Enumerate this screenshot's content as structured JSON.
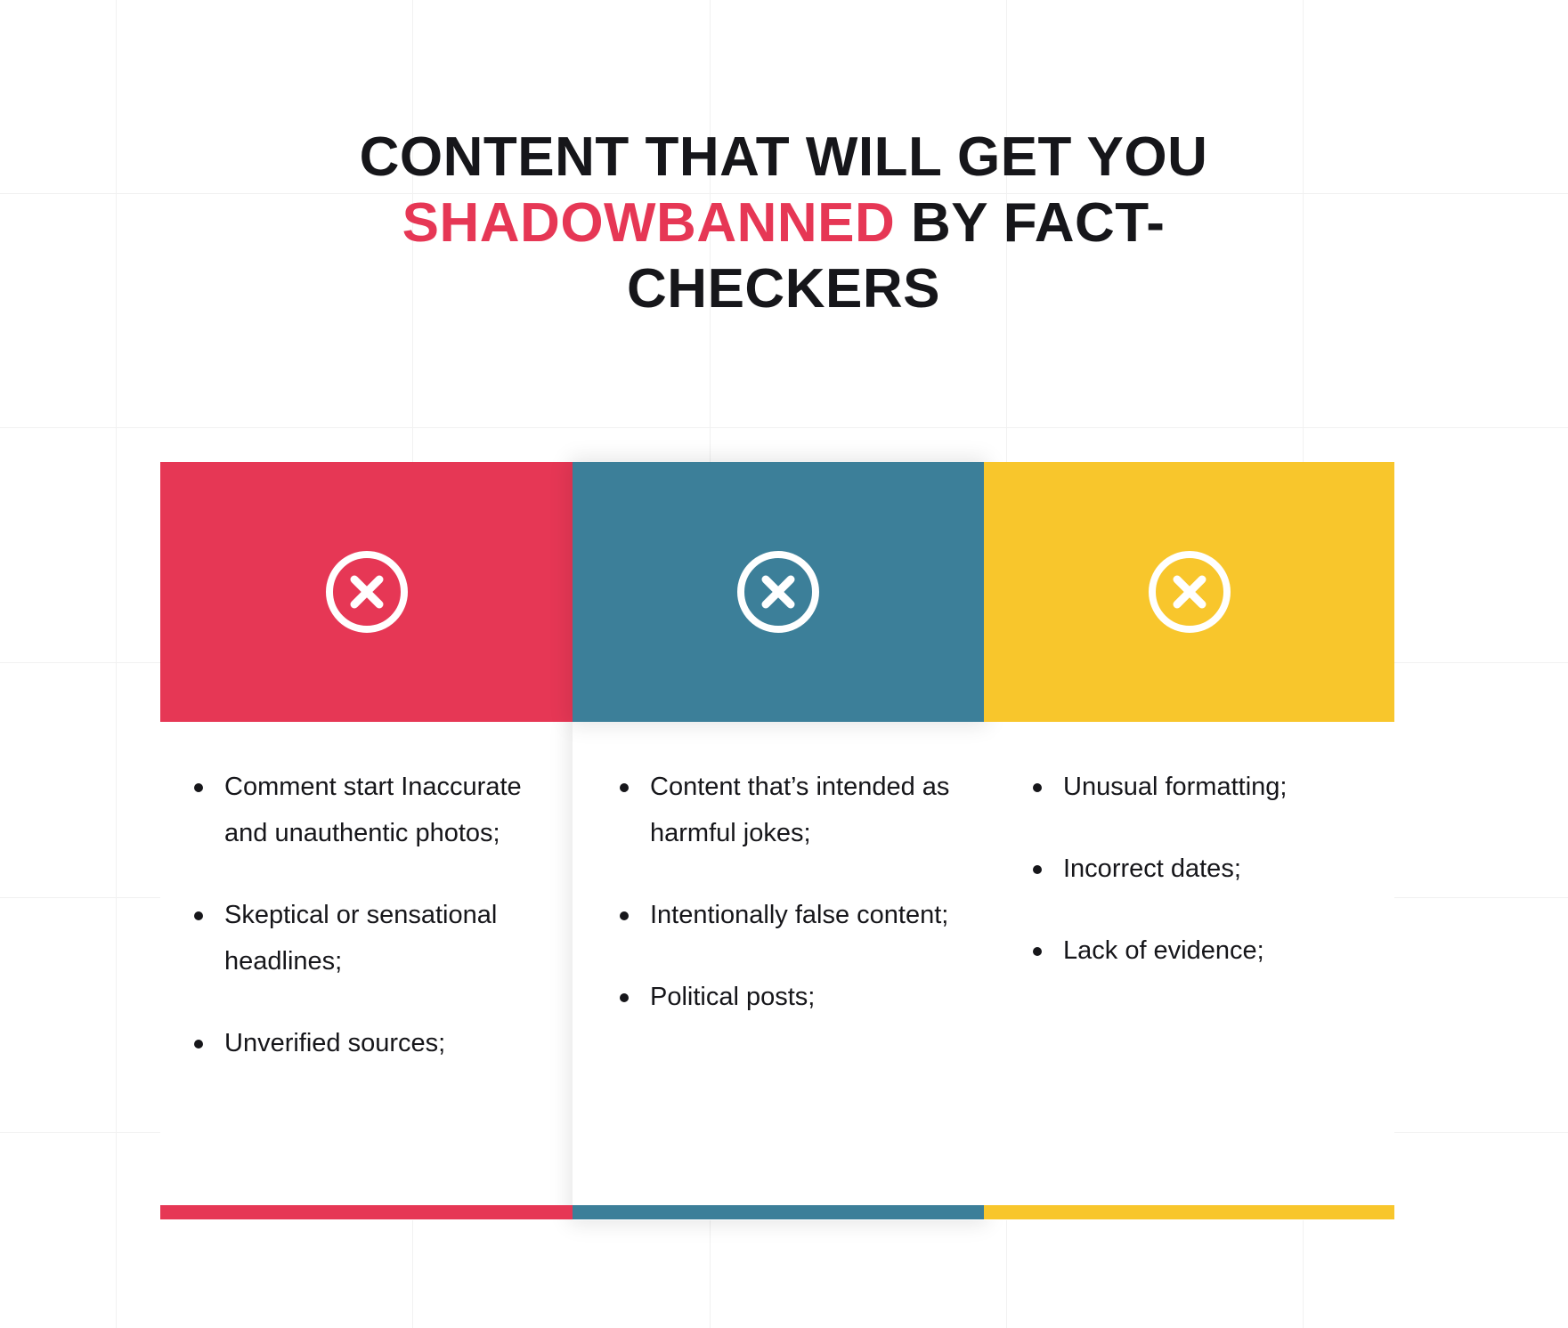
{
  "title": {
    "part1": "Content that will get you ",
    "highlight": "shadowbanned",
    "part2": " by fact-checkers",
    "highlight_color": "#e63755"
  },
  "columns": [
    {
      "id": "column-red",
      "accent_color": "#e63755",
      "icon": "circle-x-icon",
      "bullets": [
        "Comment start Inaccurate and unauthentic photos;",
        "Skeptical or sensational headlines;",
        "Unverified sources;"
      ]
    },
    {
      "id": "column-blue",
      "accent_color": "#3c7f99",
      "icon": "circle-x-icon",
      "bullets": [
        "Content that’s intended as harmful jokes;",
        "Intentionally false content;",
        "Political posts;"
      ]
    },
    {
      "id": "column-yellow",
      "accent_color": "#f8c62c",
      "icon": "circle-x-icon",
      "bullets": [
        "Unusual formatting;",
        "Incorrect dates;",
        "Lack of evidence;"
      ]
    }
  ],
  "background": {
    "color": "#ffffff",
    "grid_line_color": "#f1f1f1"
  }
}
